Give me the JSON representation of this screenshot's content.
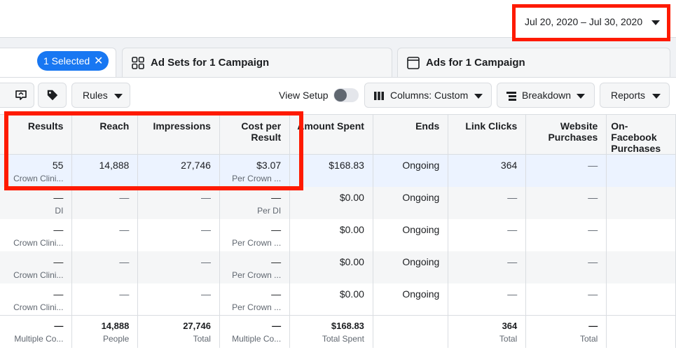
{
  "date_range": {
    "label": "Jul 20, 2020 – Jul 30, 2020"
  },
  "tabs": {
    "selected_pill": "1 Selected",
    "pill_close": "✕",
    "adsets": "Ad Sets for 1 Campaign",
    "ads": "Ads for 1 Campaign"
  },
  "toolbar": {
    "rules": "Rules",
    "view_setup": "View Setup",
    "columns": "Columns: Custom",
    "breakdown": "Breakdown",
    "reports": "Reports"
  },
  "icons": {
    "review": "review-changes-icon",
    "tag": "tag-icon",
    "columns": "columns-icon",
    "breakdown": "breakdown-icon",
    "adsets": "grid-icon",
    "ads": "window-icon"
  },
  "colors": {
    "accent": "#1877f2",
    "annotation": "#fe1a00",
    "highlight_row": "#ecf3ff"
  },
  "table": {
    "columns": [
      "Results",
      "Reach",
      "Impressions",
      "Cost per Result",
      "Amount Spent",
      "Ends",
      "Link Clicks",
      "Website Purchases",
      "On-Facebook Purchases"
    ],
    "rows": [
      {
        "results": "55",
        "results_sub": "Crown Clini...",
        "reach": "14,888",
        "impressions": "27,746",
        "cost": "$3.07",
        "cost_sub": "Per Crown ...",
        "spent": "$168.83",
        "ends": "Ongoing",
        "clicks": "364",
        "purchases": "—",
        "onfb": ""
      },
      {
        "results": "—",
        "results_sub": "DI",
        "reach": "—",
        "impressions": "—",
        "cost": "—",
        "cost_sub": "Per DI",
        "spent": "$0.00",
        "ends": "Ongoing",
        "clicks": "—",
        "purchases": "—",
        "onfb": ""
      },
      {
        "results": "—",
        "results_sub": "Crown Clini...",
        "reach": "—",
        "impressions": "—",
        "cost": "—",
        "cost_sub": "Per Crown ...",
        "spent": "$0.00",
        "ends": "Ongoing",
        "clicks": "—",
        "purchases": "—",
        "onfb": ""
      },
      {
        "results": "—",
        "results_sub": "Crown Clini...",
        "reach": "—",
        "impressions": "—",
        "cost": "—",
        "cost_sub": "Per Crown ...",
        "spent": "$0.00",
        "ends": "Ongoing",
        "clicks": "—",
        "purchases": "—",
        "onfb": ""
      },
      {
        "results": "—",
        "results_sub": "Crown Clini...",
        "reach": "—",
        "impressions": "—",
        "cost": "—",
        "cost_sub": "Per Crown ...",
        "spent": "$0.00",
        "ends": "Ongoing",
        "clicks": "—",
        "purchases": "—",
        "onfb": ""
      }
    ],
    "totals": {
      "results": "—",
      "results_sub": "Multiple Co...",
      "reach": "14,888",
      "reach_sub": "People",
      "impressions": "27,746",
      "impressions_sub": "Total",
      "cost": "—",
      "cost_sub": "Multiple Co...",
      "spent": "$168.83",
      "spent_sub": "Total Spent",
      "ends": "",
      "clicks": "364",
      "clicks_sub": "Total",
      "purchases": "—",
      "purchases_sub": "Total",
      "onfb": ""
    }
  }
}
